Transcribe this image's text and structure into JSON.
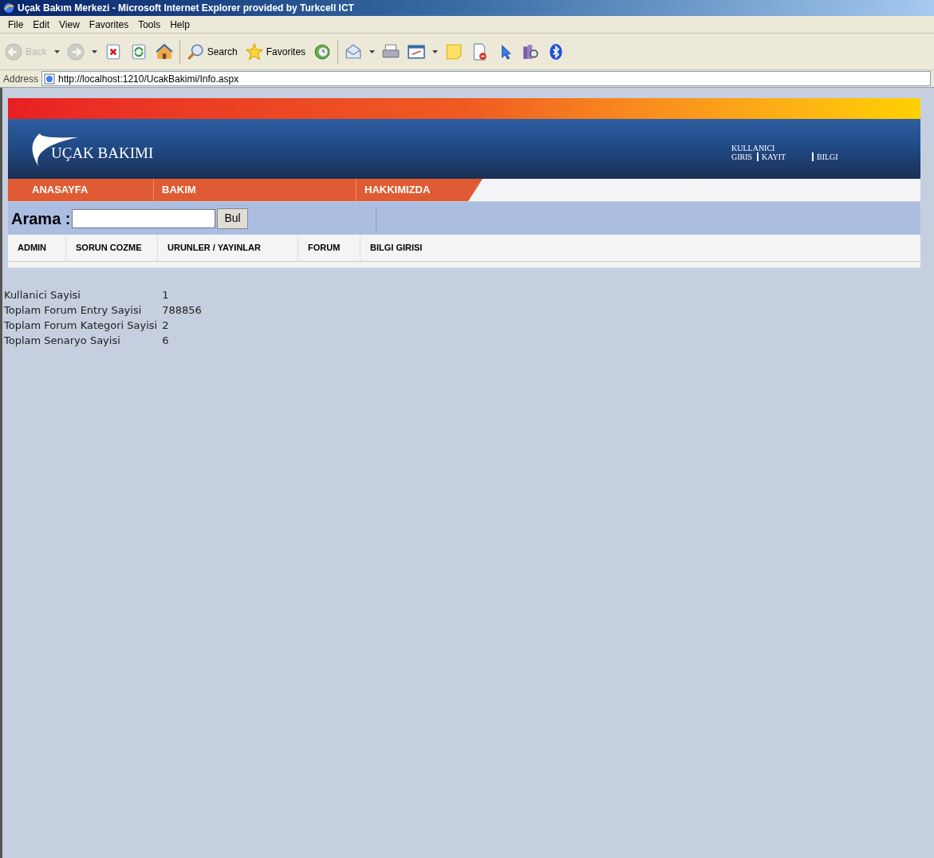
{
  "window": {
    "title": "Uçak Bakım Merkezi - Microsoft Internet Explorer provided by Turkcell ICT"
  },
  "menu": [
    "File",
    "Edit",
    "View",
    "Favorites",
    "Tools",
    "Help"
  ],
  "toolbar": [
    {
      "kind": "back",
      "label": "Back",
      "dropdown": true,
      "disabled": true
    },
    {
      "kind": "forward",
      "dropdown": true,
      "disabled": true
    },
    {
      "kind": "stop",
      "dropdown": false,
      "disabled": false
    },
    {
      "kind": "refresh",
      "dropdown": false,
      "disabled": false
    },
    {
      "kind": "home",
      "dropdown": false,
      "disabled": false
    },
    {
      "kind": "search",
      "label": "Search",
      "dropdown": false,
      "disabled": false
    },
    {
      "kind": "favorites",
      "label": "Favorites",
      "dropdown": false,
      "disabled": false
    },
    {
      "kind": "history",
      "dropdown": false,
      "disabled": false
    },
    {
      "kind": "mail",
      "dropdown": true,
      "disabled": false
    },
    {
      "kind": "print",
      "dropdown": false,
      "disabled": false
    },
    {
      "kind": "edit",
      "dropdown": true,
      "disabled": false
    },
    {
      "kind": "note",
      "dropdown": false,
      "disabled": false
    },
    {
      "kind": "document",
      "dropdown": false,
      "disabled": false
    },
    {
      "kind": "cursor",
      "dropdown": false,
      "disabled": false
    },
    {
      "kind": "research",
      "dropdown": false,
      "disabled": false
    },
    {
      "kind": "bluetooth",
      "dropdown": false,
      "disabled": false
    }
  ],
  "address": {
    "label": "Address",
    "url": "http://localhost:1210/UcakBakimi/Info.aspx"
  },
  "site": {
    "logo": "UÇAK BAKIMI",
    "user_label": "KULLANICI",
    "user_links": [
      "GIRIS",
      "KAYIT",
      "BILGI"
    ],
    "nav": [
      "ANASAYFA",
      "BAKIM",
      "HAKKIMIZDA"
    ],
    "search": {
      "label": "Arama :",
      "button": "Bul"
    },
    "submenu": [
      "ADMIN",
      "SORUN COZME",
      "URUNLER / YAYINLAR",
      "FORUM",
      "BILGI GIRISI"
    ],
    "stats": [
      {
        "label": "Kullanici Sayisi",
        "value": "1"
      },
      {
        "label": "Toplam Forum Entry Sayisi",
        "value": "788856"
      },
      {
        "label": "Toplam Forum Kategori Sayisi",
        "value": "2"
      },
      {
        "label": "Toplam Senaryo Sayisi",
        "value": "6"
      }
    ]
  }
}
